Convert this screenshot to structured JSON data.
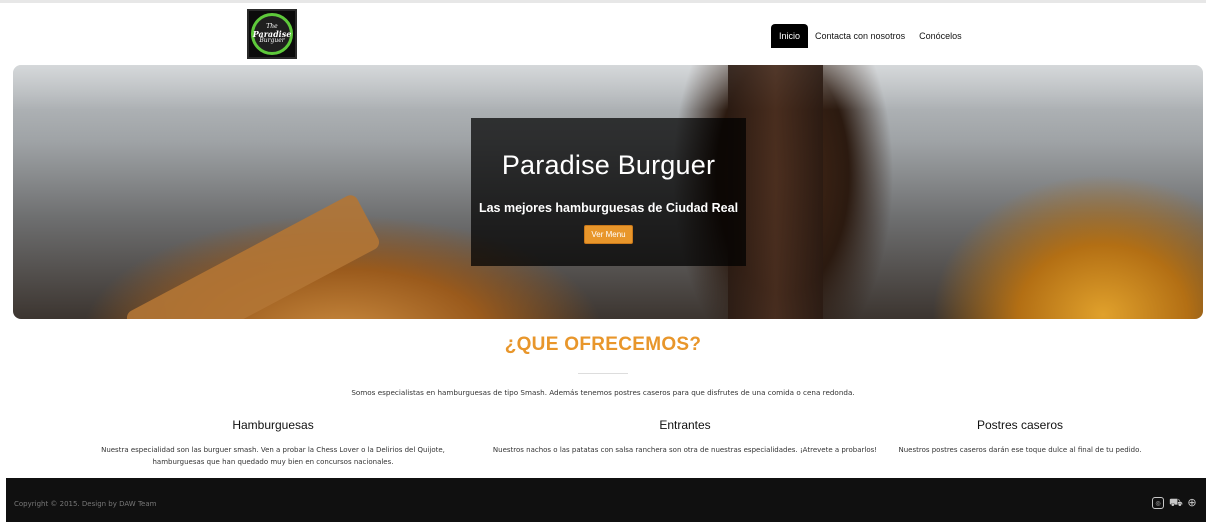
{
  "logo": {
    "line1": "The",
    "line2": "Paradise",
    "line3": "Burguer"
  },
  "nav": {
    "items": [
      {
        "label": "Inicio",
        "active": true
      },
      {
        "label": "Contacta con nosotros",
        "active": false
      },
      {
        "label": "Conócelos",
        "active": false
      }
    ]
  },
  "hero": {
    "title": "Paradise Burguer",
    "subtitle": "Las mejores hamburguesas de Ciudad Real",
    "button": "Ver Menu"
  },
  "offer": {
    "title": "¿QUE OFRECEMOS?",
    "intro": "Somos especialistas en hamburguesas de tipo Smash. Además tenemos postres caseros para que disfrutes de una comida o cena redonda.",
    "columns": [
      {
        "title": "Hamburguesas",
        "text": "Nuestra especialidad son las burguer smash. Ven a probar la Chess Lover o la Delirios del Quijote, hamburguesas que han quedado muy bien en concursos nacionales."
      },
      {
        "title": "Entrantes",
        "text": "Nuestros nachos o las patatas con salsa ranchera son otra de nuestras especialidades. ¡Atrevete a probarlos!"
      },
      {
        "title": "Postres caseros",
        "text": "Nuestros postres caseros darán ese toque dulce al final de tu pedido."
      }
    ]
  },
  "footer": {
    "copyright": "Copyright © 2015. Design by DAW Team",
    "icons": [
      "instagram-icon",
      "delivery-truck-icon",
      "globe-icon"
    ]
  },
  "colors": {
    "accent": "#e8962b",
    "footer": "#101010",
    "nav_active": "#000000"
  }
}
